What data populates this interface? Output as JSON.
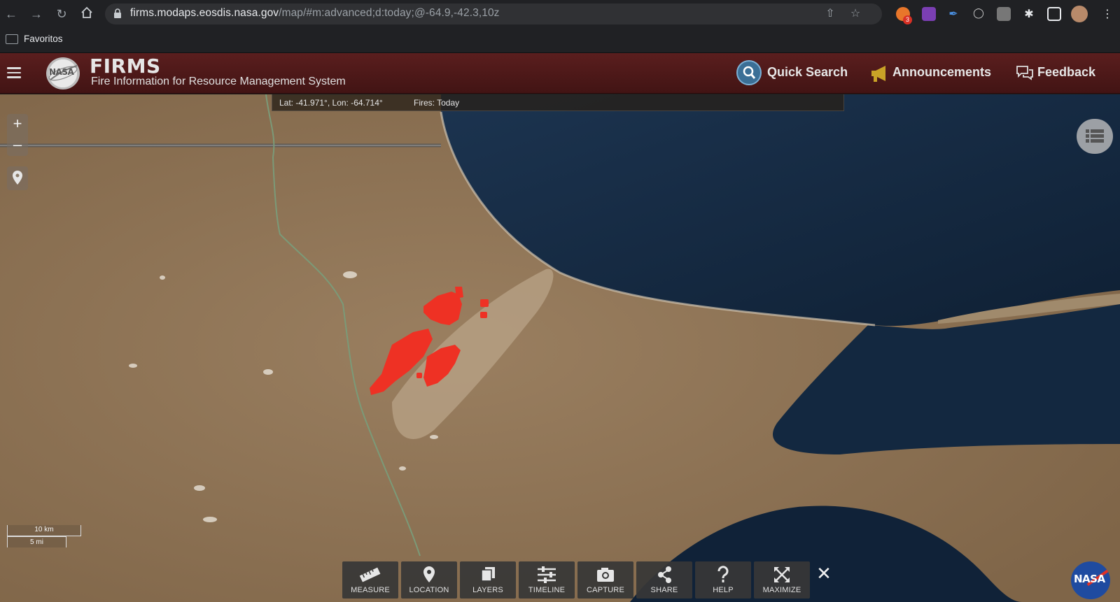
{
  "browser": {
    "url_host": "firms.modaps.eosdis.nasa.gov",
    "url_path": "/map/#m:advanced;d:today;@-64.9,-42.3,10z",
    "bookmarks_folder": "Favoritos",
    "extension_badge": "3"
  },
  "header": {
    "title": "FIRMS",
    "subtitle": "Fire Information for Resource Management System",
    "logo_text": "NASA",
    "quick_search": "Quick Search",
    "announcements": "Announcements",
    "feedback": "Feedback"
  },
  "map": {
    "coords": "Lat: -41.971°, Lon: -64.714°",
    "fires": "Fires: Today",
    "scale_km": "10 km",
    "scale_mi": "5 mi",
    "zoom_in": "+",
    "zoom_out": "–"
  },
  "toolbar": {
    "measure": "MEASURE",
    "location": "LOCATION",
    "layers": "LAYERS",
    "timeline": "TIMELINE",
    "capture": "CAPTURE",
    "share": "SHARE",
    "help": "HELP",
    "maximize": "MAXIMIZE",
    "close": "✕"
  },
  "corner_logo": "NASA",
  "colors": {
    "header_bg": "#4e1a1a",
    "fire_red": "#ee3124",
    "land": "#8e7457",
    "sea": "#13273e",
    "toolbar_bg": "#373737"
  }
}
